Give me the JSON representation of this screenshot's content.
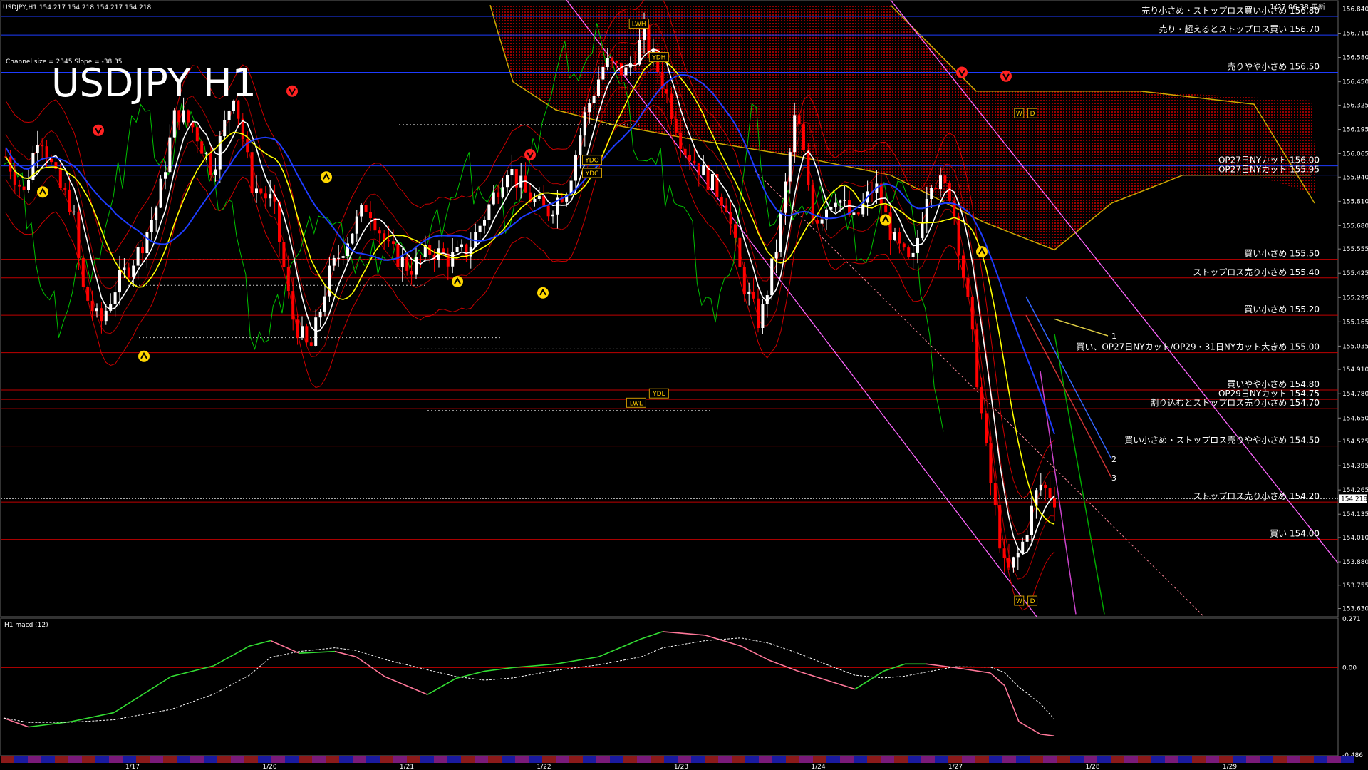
{
  "header": {
    "symbol_line": "USDJPY,H1  154.217 154.218 154.217 154.218",
    "updated": "1/27 06:38 更新",
    "big_title": "USDJPY H1",
    "channel_info": "Channel size = 2345 Slope = -38.35"
  },
  "indicator_label": "H1  macd (12)",
  "colors": {
    "bullish": "#ffffff",
    "bearish": "#ff0000",
    "level_line": "#c00000",
    "blue_line": "#1e3cff",
    "fast_ma": "#ffffff",
    "slow_ma": "#ffff00",
    "green": "#00c000",
    "channel": "#ff66ff",
    "cloud": "#b00000",
    "macd_up": "#33dd33",
    "macd_down": "#ff7799"
  },
  "chart_data": [
    {
      "type": "candlestick",
      "title": "USDJPY H1",
      "y_ticks": [
        "156.840",
        "156.710",
        "156.580",
        "156.450",
        "156.325",
        "156.195",
        "156.065",
        "155.940",
        "155.810",
        "155.680",
        "155.555",
        "155.425",
        "155.295",
        "155.165",
        "155.035",
        "154.910",
        "154.780",
        "154.650",
        "154.525",
        "154.395",
        "154.265",
        "154.135",
        "154.010",
        "153.880",
        "153.755",
        "153.630"
      ],
      "ylim": [
        153.59,
        156.88
      ],
      "current_price": "154.218",
      "x_labels": [
        "1/17",
        "1/20",
        "1/21",
        "1/22",
        "1/23",
        "1/24",
        "1/27",
        "1/28",
        "1/29"
      ],
      "levels": [
        {
          "price": 156.8,
          "label": "売り小さめ・ストップロス買い小さめ 156.80",
          "color": "blue"
        },
        {
          "price": 156.7,
          "label": "売り・超えるとストップロス買い 156.70",
          "color": "blue"
        },
        {
          "price": 156.5,
          "label": "売りやや小さめ 156.50",
          "color": "blue"
        },
        {
          "price": 156.0,
          "label": "OP27日NYカット 156.00",
          "color": "blue"
        },
        {
          "price": 155.95,
          "label": "OP27日NYカット 155.95",
          "color": "blue"
        },
        {
          "price": 155.5,
          "label": "買い小さめ 155.50",
          "color": "red"
        },
        {
          "price": 155.4,
          "label": "ストップロス売り小さめ 155.40",
          "color": "red"
        },
        {
          "price": 155.2,
          "label": "買い小さめ 155.20",
          "color": "red"
        },
        {
          "price": 155.0,
          "label": "買い、OP27日NYカット/OP29・31日NYカット大きめ 155.00",
          "color": "red"
        },
        {
          "price": 154.8,
          "label": "買いやや小さめ 154.80",
          "color": "red"
        },
        {
          "price": 154.75,
          "label": "OP29日NYカット 154.75",
          "color": "red"
        },
        {
          "price": 154.7,
          "label": "割り込むとストップロス売り小さめ 154.70",
          "color": "red"
        },
        {
          "price": 154.5,
          "label": "買い小さめ・ストップロス売りやや小さめ 154.50",
          "color": "red"
        },
        {
          "price": 154.2,
          "label": "ストップロス売り小さめ 154.20",
          "color": "red"
        },
        {
          "price": 154.0,
          "label": "買い 154.00",
          "color": "red"
        }
      ],
      "markers": [
        {
          "label": "LWH",
          "x_pct": 0.47,
          "price": 156.76
        },
        {
          "label": "YDH",
          "x_pct": 0.485,
          "price": 156.58
        },
        {
          "label": "YDO",
          "x_pct": 0.435,
          "price": 156.03
        },
        {
          "label": "YDC",
          "x_pct": 0.435,
          "price": 155.96
        },
        {
          "label": "YDL",
          "x_pct": 0.485,
          "price": 154.78
        },
        {
          "label": "LWL",
          "x_pct": 0.468,
          "price": 154.73
        },
        {
          "label": "W",
          "x_pct": 0.758,
          "price": 156.28
        },
        {
          "label": "D",
          "x_pct": 0.768,
          "price": 156.28
        },
        {
          "label": "W",
          "x_pct": 0.758,
          "price": 153.67
        },
        {
          "label": "D",
          "x_pct": 0.768,
          "price": 153.67
        }
      ],
      "projection_labels": [
        {
          "label": "1",
          "price": 155.09
        },
        {
          "label": "2",
          "price": 154.43
        },
        {
          "label": "3",
          "price": 154.33
        }
      ]
    },
    {
      "type": "line",
      "title": "H1 macd (12)",
      "y_ticks": [
        "0.271",
        "0.00",
        "-0.486"
      ],
      "ylim": [
        -0.486,
        0.271
      ]
    }
  ]
}
